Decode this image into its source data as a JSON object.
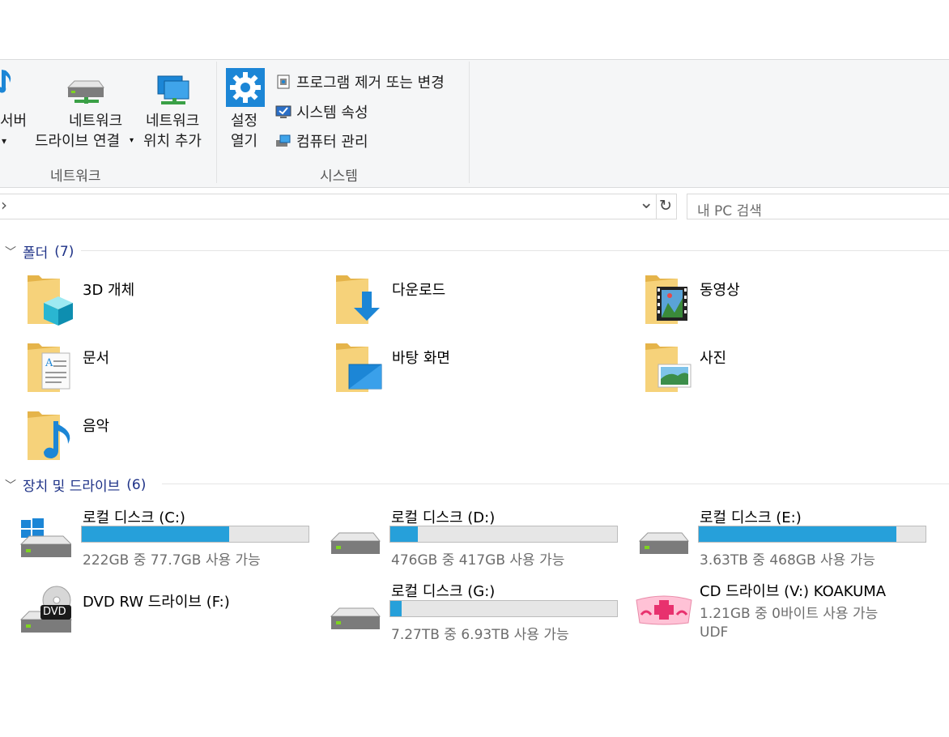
{
  "ribbon": {
    "network_group": {
      "label": "네트워크",
      "items": [
        {
          "label_line1": "서버",
          "label_line2": "▾"
        },
        {
          "label_line1": "네트워크",
          "label_line2": "드라이브 연결"
        },
        {
          "label_line1": "네트워크",
          "label_line2": "위치 추가"
        }
      ]
    },
    "system_group": {
      "label": "시스템",
      "settings_line1": "설정",
      "settings_line2": "열기",
      "small_items": [
        "프로그램 제거 또는 변경",
        "시스템 속성",
        "컴퓨터 관리"
      ]
    }
  },
  "address_bar": {
    "chevron": "›",
    "dropdown": "⌄",
    "refresh": "↻"
  },
  "search": {
    "placeholder": "내 PC 검색"
  },
  "folders_section": {
    "title": "폴더",
    "count": "(7)",
    "items": [
      "3D 개체",
      "다운로드",
      "동영상",
      "문서",
      "바탕 화면",
      "사진",
      "음악"
    ]
  },
  "drives_section": {
    "title": "장치 및 드라이브",
    "count": "(6)",
    "drives": [
      {
        "name": "로컬 디스크 (C:)",
        "space": "222GB 중 77.7GB 사용 가능",
        "used_fraction": 0.65
      },
      {
        "name": "로컬 디스크 (D:)",
        "space": "476GB 중 417GB 사용 가능",
        "used_fraction": 0.12
      },
      {
        "name": "로컬 디스크 (E:)",
        "space": "3.63TB 중 468GB 사용 가능",
        "used_fraction": 0.87
      },
      {
        "name": "DVD RW 드라이브 (F:)",
        "dvd_badge": "DVD"
      },
      {
        "name": "로컬 디스크 (G:)",
        "space": "7.27TB 중 6.93TB 사용 가능",
        "used_fraction": 0.05
      },
      {
        "name": "CD 드라이브 (V:) KOAKUMA",
        "space": "1.21GB 중 0바이트 사용 가능",
        "fs": "UDF"
      }
    ]
  },
  "colors": {
    "accent": "#26a0da",
    "folder": "#f0c75e",
    "section_text": "#1e3287"
  }
}
